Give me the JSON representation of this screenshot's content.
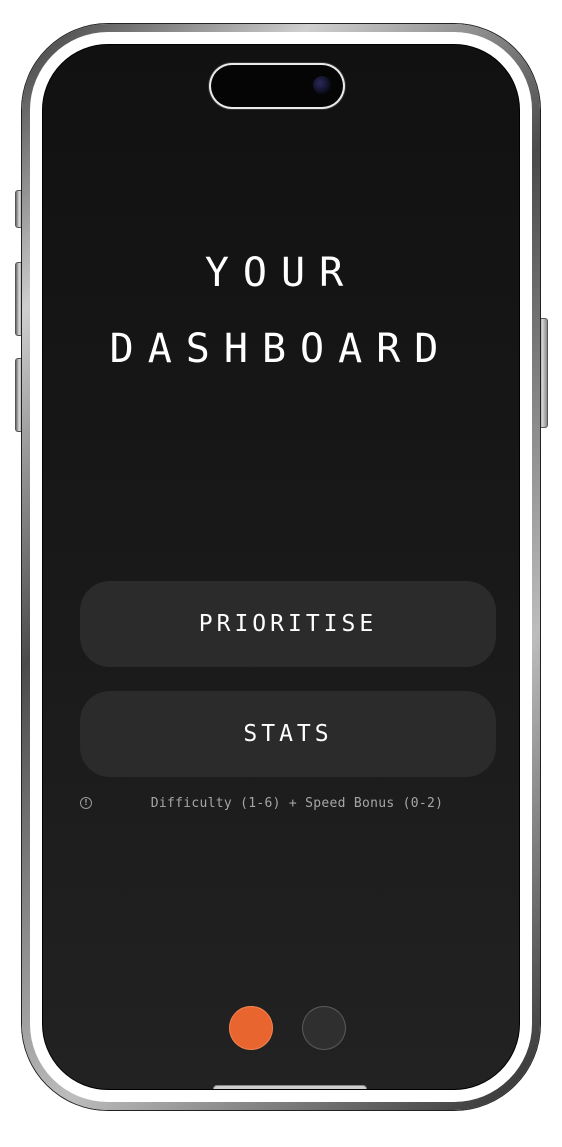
{
  "dashboard": {
    "title_line1": "YOUR",
    "title_line2": "DASHBOARD"
  },
  "actions": {
    "prioritise_label": "PRIORITISE",
    "stats_label": "STATS"
  },
  "info": {
    "icon": "info-circle-icon",
    "text": "Difficulty (1-6) + Speed Bonus (0-2)"
  },
  "pagination": {
    "pages": 2,
    "active_index": 0,
    "active_color": "#e8652f",
    "inactive_color": "#2f2f2f"
  },
  "colors": {
    "screen_background": "#1a1a1a",
    "button_background": "#2b2b2b",
    "text_primary": "#ffffff",
    "text_secondary": "#a6a6a6"
  }
}
